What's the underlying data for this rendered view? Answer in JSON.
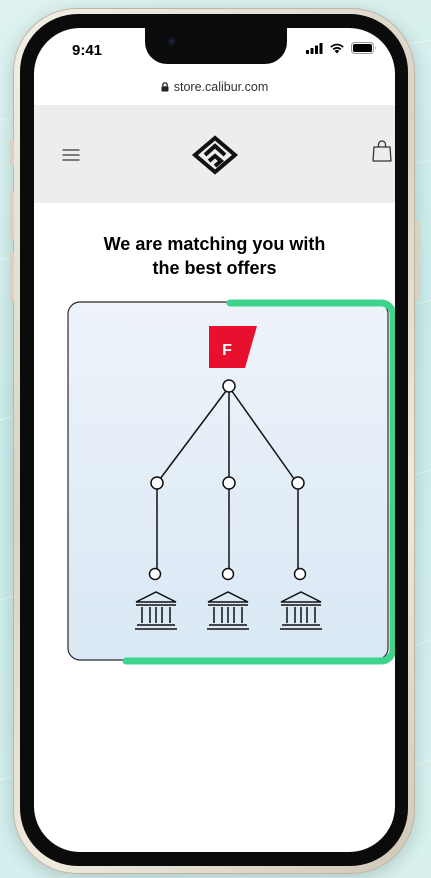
{
  "status_bar": {
    "time": "9:41"
  },
  "browser": {
    "url": "store.calibur.com"
  },
  "header": {
    "menu_icon": "hamburger-menu-icon",
    "logo": "calibur-logo",
    "cart_icon": "shopping-bag-icon"
  },
  "main": {
    "headline_line1": "We are matching you with",
    "headline_line2": "the best offers",
    "badge_letter": "F",
    "bank_count_icons": [
      "bank-icon",
      "bank-icon",
      "bank-icon"
    ]
  },
  "colors": {
    "accent_green": "#3ed48d",
    "badge_red": "#e8102e",
    "card_bg_top": "#edf2fa",
    "card_bg_bottom": "#dae8f4"
  }
}
